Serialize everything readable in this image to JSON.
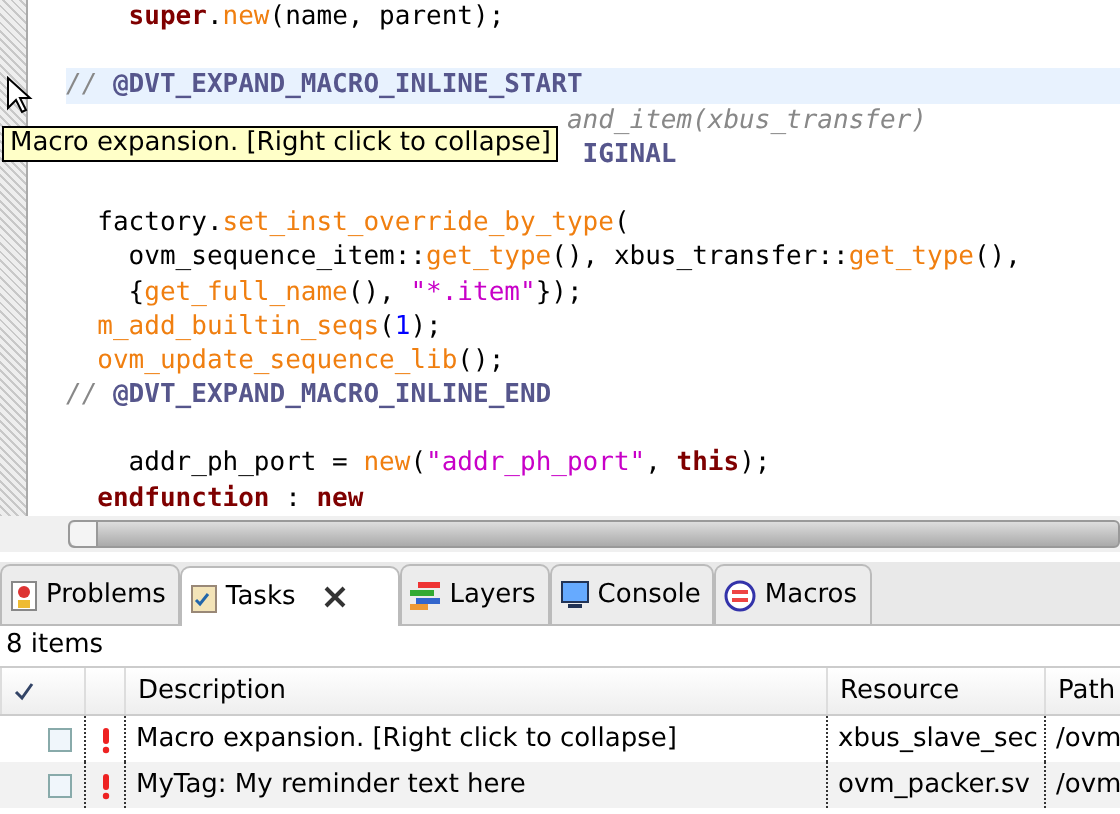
{
  "editor": {
    "lines": [
      {
        "kind": "code",
        "highlighted": false,
        "tokens": [
          {
            "kind": "kw",
            "text": "    super"
          },
          {
            "kind": "plain",
            "text": "."
          },
          {
            "kind": "fn",
            "text": "new"
          },
          {
            "kind": "plain",
            "text": "(name, parent);"
          }
        ]
      },
      {
        "kind": "blank",
        "highlighted": false
      },
      {
        "kind": "code",
        "highlighted": true,
        "tokens": [
          {
            "kind": "comment",
            "text": "// "
          },
          {
            "kind": "macro",
            "text": "@DVT_EXPAND_MACRO_INLINE_START"
          }
        ]
      },
      {
        "kind": "covered",
        "highlighted": false,
        "tokens": [
          {
            "kind": "comment",
            "text": "and_item(xbus_transfer)"
          }
        ]
      },
      {
        "kind": "covered",
        "highlighted": false,
        "tokens": [
          {
            "kind": "macro",
            "text": "IGINAL"
          }
        ]
      },
      {
        "kind": "blank",
        "highlighted": false
      },
      {
        "kind": "code",
        "highlighted": false,
        "tokens": [
          {
            "kind": "plain",
            "text": "  factory."
          },
          {
            "kind": "fn",
            "text": "set_inst_override_by_type"
          },
          {
            "kind": "plain",
            "text": "("
          }
        ]
      },
      {
        "kind": "code",
        "highlighted": false,
        "tokens": [
          {
            "kind": "plain",
            "text": "    ovm_sequence_item::"
          },
          {
            "kind": "fn",
            "text": "get_type"
          },
          {
            "kind": "plain",
            "text": "(), xbus_transfer::"
          },
          {
            "kind": "fn",
            "text": "get_type"
          },
          {
            "kind": "plain",
            "text": "(),"
          }
        ]
      },
      {
        "kind": "code",
        "highlighted": false,
        "tokens": [
          {
            "kind": "plain",
            "text": "    {"
          },
          {
            "kind": "fn",
            "text": "get_full_name"
          },
          {
            "kind": "plain",
            "text": "(), "
          },
          {
            "kind": "str",
            "text": "\"*.item\""
          },
          {
            "kind": "plain",
            "text": "});"
          }
        ]
      },
      {
        "kind": "code",
        "highlighted": false,
        "tokens": [
          {
            "kind": "fn",
            "text": "  m_add_builtin_seqs"
          },
          {
            "kind": "plain",
            "text": "("
          },
          {
            "kind": "num",
            "text": "1"
          },
          {
            "kind": "plain",
            "text": ");"
          }
        ]
      },
      {
        "kind": "code",
        "highlighted": false,
        "tokens": [
          {
            "kind": "fn",
            "text": "  ovm_update_sequence_lib"
          },
          {
            "kind": "plain",
            "text": "();"
          }
        ]
      },
      {
        "kind": "code",
        "highlighted": false,
        "tokens": [
          {
            "kind": "comment",
            "text": "// "
          },
          {
            "kind": "macro",
            "text": "@DVT_EXPAND_MACRO_INLINE_END"
          }
        ]
      },
      {
        "kind": "blank",
        "highlighted": false
      },
      {
        "kind": "code",
        "highlighted": false,
        "tokens": [
          {
            "kind": "plain",
            "text": "    addr_ph_port = "
          },
          {
            "kind": "fn",
            "text": "new"
          },
          {
            "kind": "plain",
            "text": "("
          },
          {
            "kind": "str",
            "text": "\"addr_ph_port\""
          },
          {
            "kind": "plain",
            "text": ", "
          },
          {
            "kind": "kw",
            "text": "this"
          },
          {
            "kind": "plain",
            "text": ");"
          }
        ]
      },
      {
        "kind": "code",
        "highlighted": false,
        "tokens": [
          {
            "kind": "kw",
            "text": "  endfunction"
          },
          {
            "kind": "plain",
            "text": " : "
          },
          {
            "kind": "kw",
            "text": "new"
          }
        ]
      }
    ],
    "tooltip": "Macro expansion. [Right click to collapse]"
  },
  "tabs": [
    {
      "label": "Problems",
      "selected": false,
      "closable": false
    },
    {
      "label": "Tasks",
      "selected": true,
      "closable": true
    },
    {
      "label": "Layers",
      "selected": false,
      "closable": false
    },
    {
      "label": "Console",
      "selected": false,
      "closable": false
    },
    {
      "label": "Macros",
      "selected": false,
      "closable": false
    }
  ],
  "tasks": {
    "count": "8 items",
    "columns": [
      "Description",
      "Resource",
      "Path"
    ],
    "rows": [
      {
        "checked": false,
        "description": "Macro expansion. [Right click to collapse]",
        "resource": "xbus_slave_sec",
        "path": "/ovm"
      },
      {
        "checked": false,
        "description": "MyTag: My reminder text here",
        "resource": "ovm_packer.sv",
        "path": "/ovm"
      }
    ]
  }
}
